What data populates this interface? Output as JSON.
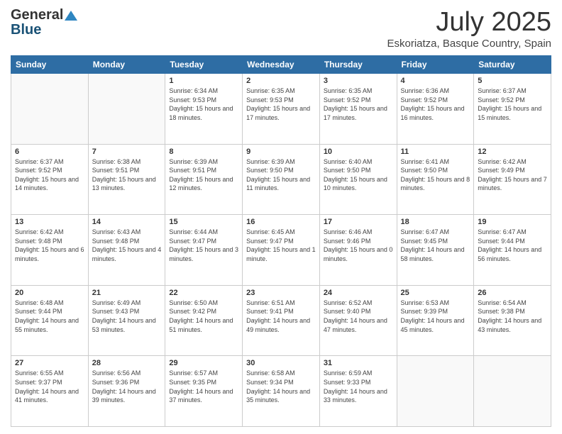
{
  "header": {
    "logo_general": "General",
    "logo_blue": "Blue",
    "title": "July 2025",
    "subtitle": "Eskoriatza, Basque Country, Spain"
  },
  "days_of_week": [
    "Sunday",
    "Monday",
    "Tuesday",
    "Wednesday",
    "Thursday",
    "Friday",
    "Saturday"
  ],
  "weeks": [
    {
      "days": [
        {
          "number": "",
          "empty": true
        },
        {
          "number": "",
          "empty": true
        },
        {
          "number": "1",
          "sunrise": "6:34 AM",
          "sunset": "9:53 PM",
          "daylight": "15 hours and 18 minutes."
        },
        {
          "number": "2",
          "sunrise": "6:35 AM",
          "sunset": "9:53 PM",
          "daylight": "15 hours and 17 minutes."
        },
        {
          "number": "3",
          "sunrise": "6:35 AM",
          "sunset": "9:52 PM",
          "daylight": "15 hours and 17 minutes."
        },
        {
          "number": "4",
          "sunrise": "6:36 AM",
          "sunset": "9:52 PM",
          "daylight": "15 hours and 16 minutes."
        },
        {
          "number": "5",
          "sunrise": "6:37 AM",
          "sunset": "9:52 PM",
          "daylight": "15 hours and 15 minutes."
        }
      ]
    },
    {
      "days": [
        {
          "number": "6",
          "sunrise": "6:37 AM",
          "sunset": "9:52 PM",
          "daylight": "15 hours and 14 minutes."
        },
        {
          "number": "7",
          "sunrise": "6:38 AM",
          "sunset": "9:51 PM",
          "daylight": "15 hours and 13 minutes."
        },
        {
          "number": "8",
          "sunrise": "6:39 AM",
          "sunset": "9:51 PM",
          "daylight": "15 hours and 12 minutes."
        },
        {
          "number": "9",
          "sunrise": "6:39 AM",
          "sunset": "9:50 PM",
          "daylight": "15 hours and 11 minutes."
        },
        {
          "number": "10",
          "sunrise": "6:40 AM",
          "sunset": "9:50 PM",
          "daylight": "15 hours and 10 minutes."
        },
        {
          "number": "11",
          "sunrise": "6:41 AM",
          "sunset": "9:50 PM",
          "daylight": "15 hours and 8 minutes."
        },
        {
          "number": "12",
          "sunrise": "6:42 AM",
          "sunset": "9:49 PM",
          "daylight": "15 hours and 7 minutes."
        }
      ]
    },
    {
      "days": [
        {
          "number": "13",
          "sunrise": "6:42 AM",
          "sunset": "9:48 PM",
          "daylight": "15 hours and 6 minutes."
        },
        {
          "number": "14",
          "sunrise": "6:43 AM",
          "sunset": "9:48 PM",
          "daylight": "15 hours and 4 minutes."
        },
        {
          "number": "15",
          "sunrise": "6:44 AM",
          "sunset": "9:47 PM",
          "daylight": "15 hours and 3 minutes."
        },
        {
          "number": "16",
          "sunrise": "6:45 AM",
          "sunset": "9:47 PM",
          "daylight": "15 hours and 1 minute."
        },
        {
          "number": "17",
          "sunrise": "6:46 AM",
          "sunset": "9:46 PM",
          "daylight": "15 hours and 0 minutes."
        },
        {
          "number": "18",
          "sunrise": "6:47 AM",
          "sunset": "9:45 PM",
          "daylight": "14 hours and 58 minutes."
        },
        {
          "number": "19",
          "sunrise": "6:47 AM",
          "sunset": "9:44 PM",
          "daylight": "14 hours and 56 minutes."
        }
      ]
    },
    {
      "days": [
        {
          "number": "20",
          "sunrise": "6:48 AM",
          "sunset": "9:44 PM",
          "daylight": "14 hours and 55 minutes."
        },
        {
          "number": "21",
          "sunrise": "6:49 AM",
          "sunset": "9:43 PM",
          "daylight": "14 hours and 53 minutes."
        },
        {
          "number": "22",
          "sunrise": "6:50 AM",
          "sunset": "9:42 PM",
          "daylight": "14 hours and 51 minutes."
        },
        {
          "number": "23",
          "sunrise": "6:51 AM",
          "sunset": "9:41 PM",
          "daylight": "14 hours and 49 minutes."
        },
        {
          "number": "24",
          "sunrise": "6:52 AM",
          "sunset": "9:40 PM",
          "daylight": "14 hours and 47 minutes."
        },
        {
          "number": "25",
          "sunrise": "6:53 AM",
          "sunset": "9:39 PM",
          "daylight": "14 hours and 45 minutes."
        },
        {
          "number": "26",
          "sunrise": "6:54 AM",
          "sunset": "9:38 PM",
          "daylight": "14 hours and 43 minutes."
        }
      ]
    },
    {
      "days": [
        {
          "number": "27",
          "sunrise": "6:55 AM",
          "sunset": "9:37 PM",
          "daylight": "14 hours and 41 minutes."
        },
        {
          "number": "28",
          "sunrise": "6:56 AM",
          "sunset": "9:36 PM",
          "daylight": "14 hours and 39 minutes."
        },
        {
          "number": "29",
          "sunrise": "6:57 AM",
          "sunset": "9:35 PM",
          "daylight": "14 hours and 37 minutes."
        },
        {
          "number": "30",
          "sunrise": "6:58 AM",
          "sunset": "9:34 PM",
          "daylight": "14 hours and 35 minutes."
        },
        {
          "number": "31",
          "sunrise": "6:59 AM",
          "sunset": "9:33 PM",
          "daylight": "14 hours and 33 minutes."
        },
        {
          "number": "",
          "empty": true
        },
        {
          "number": "",
          "empty": true
        }
      ]
    }
  ]
}
